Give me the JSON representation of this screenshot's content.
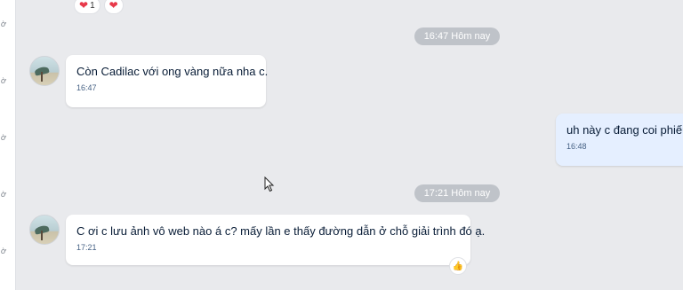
{
  "sidebar_strip": {
    "marker": "ờ"
  },
  "reactions": [
    {
      "icon": "heart-icon",
      "label": "1"
    },
    {
      "icon": "heart-icon",
      "label": ""
    }
  ],
  "separators": [
    {
      "label": "16:47 Hôm nay"
    },
    {
      "label": "17:21 Hôm nay"
    }
  ],
  "messages": [
    {
      "text": "Còn Cadilac với ong vàng nữa nha c.",
      "time": "16:47",
      "side": "incoming"
    },
    {
      "text": "uh này c đang coi phiếu",
      "time": "16:48",
      "side": "outgoing"
    },
    {
      "text": "C ơi c lưu ảnh vô web nào á c? mấy lần e thấy đường dẫn ở chỗ giải trình đó ạ.",
      "time": "17:21",
      "side": "incoming"
    }
  ],
  "colors": {
    "background": "#e9eaed",
    "incoming_bubble": "#ffffff",
    "outgoing_bubble": "#e5efff",
    "time_pill": "#bfc3c9",
    "heart": "#e8394a"
  }
}
